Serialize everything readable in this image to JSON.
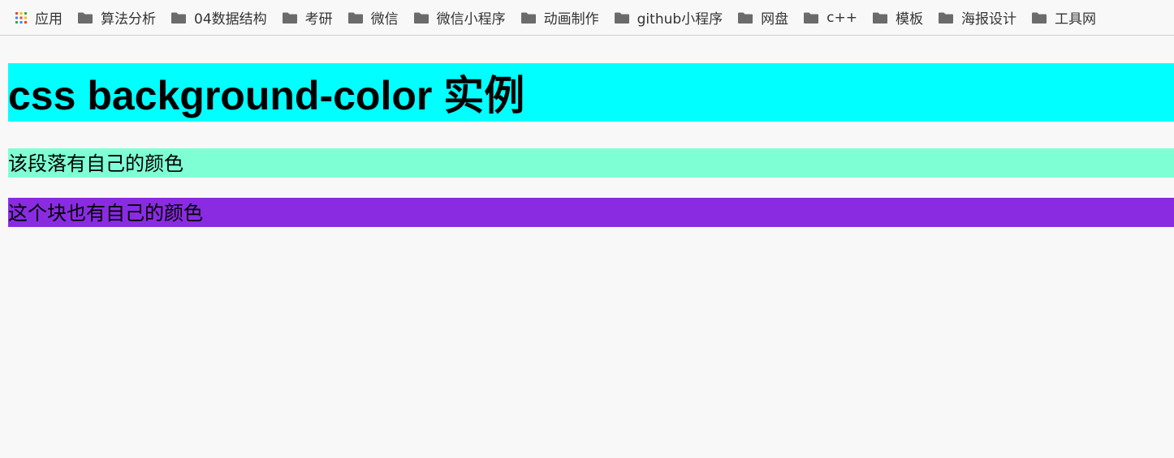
{
  "bookmarks_bar": {
    "apps_label": "应用",
    "items": [
      {
        "label": "算法分析"
      },
      {
        "label": "04数据结构"
      },
      {
        "label": "考研"
      },
      {
        "label": "微信"
      },
      {
        "label": "微信小程序"
      },
      {
        "label": "动画制作"
      },
      {
        "label": "github小程序"
      },
      {
        "label": "网盘"
      },
      {
        "label": "c++"
      },
      {
        "label": "模板"
      },
      {
        "label": "海报设计"
      },
      {
        "label": "工具网"
      }
    ],
    "folder_icon": "folder-icon",
    "apps_icon": "apps-grid-icon"
  },
  "page": {
    "heading": "css background-color 实例",
    "paragraph": "该段落有自己的颜色",
    "block": "这个块也有自己的颜色"
  },
  "colors": {
    "heading_bg": "#00ffff",
    "paragraph_bg": "#7fffd4",
    "block_bg": "#8a2be2",
    "page_bg": "#f8f8f8"
  }
}
